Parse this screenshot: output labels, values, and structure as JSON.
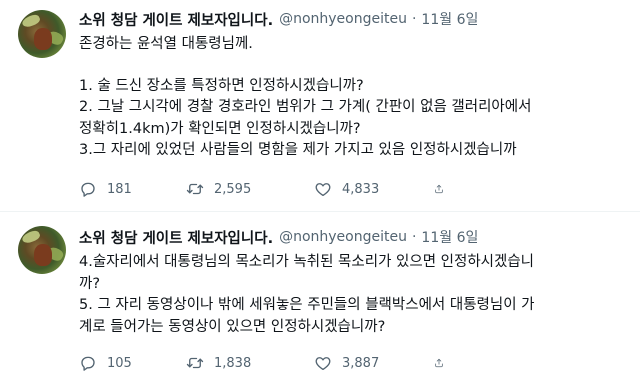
{
  "tweets": [
    {
      "name": "소위 청담 게이트 제보자입니다.",
      "handle": "@nonhyeongeiteu",
      "separator": "·",
      "date": "11월 6일",
      "lines_a": [
        "존경하는 윤석열 대통령님께."
      ],
      "lines_b": [
        "1. 술 드신 장소를 특정하면 인정하시겠습니까?",
        "2. 그날 그시각에 경찰 경호라인 범위가 그 가계( 간판이 없음 갤러리아에서",
        "정확히1.4km)가 확인되면 인정하시겠습니까?",
        "3.그 자리에 있었던 사람들의 명함을 제가 가지고 있음 인정하시겠습니까"
      ],
      "replies": "181",
      "retweets": "2,595",
      "likes": "4,833"
    },
    {
      "name": "소위 청담 게이트 제보자입니다.",
      "handle": "@nonhyeongeiteu",
      "separator": "·",
      "date": "11월 6일",
      "lines": [
        "4.술자리에서 대통령님의 목소리가 녹취된 목소리가 있으면 인정하시겠습니",
        "까?",
        "5. 그 자리 동영상이나 밖에 세워놓은 주민들의 블랙박스에서 대통령님이 가",
        "계로 들어가는 동영상이 있으면 인정하시겠습니까?"
      ],
      "replies": "105",
      "retweets": "1,838",
      "likes": "3,887"
    }
  ],
  "icons": {
    "reply": "reply-icon",
    "retweet": "retweet-icon",
    "like": "like-icon",
    "share": "share-icon"
  },
  "colors": {
    "text": "#0f1419",
    "muted": "#536471",
    "divider": "#eff3f4"
  }
}
